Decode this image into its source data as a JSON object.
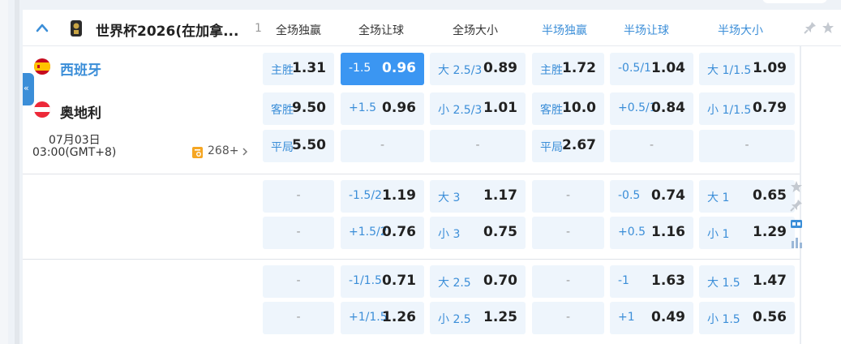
{
  "league": {
    "name": "世界杯2026(在加拿...",
    "count": "1",
    "icon": "trophy-icon"
  },
  "columns": [
    "全场独赢",
    "全场让球",
    "全场大小",
    "半场独赢",
    "半场让球",
    "半场大小"
  ],
  "colors": {
    "accent": "#3b8ed8",
    "active": "#3b96f2",
    "cell": "#eef5fc"
  },
  "match": {
    "home": "西班牙",
    "away": "奥地利",
    "date": "07月03日",
    "time": "03:00(GMT+8)",
    "more": "268+"
  },
  "rows": [
    [
      {
        "lbl": "主胜",
        "val": "1.31"
      },
      {
        "lbl": "-1.5",
        "val": "0.96",
        "active": true
      },
      {
        "lbl": "大 2.5/3",
        "val": "0.89"
      },
      {
        "lbl": "主胜",
        "val": "1.72"
      },
      {
        "lbl": "-0.5/1",
        "val": "1.04"
      },
      {
        "lbl": "大 1/1.5",
        "val": "1.09"
      }
    ],
    [
      {
        "lbl": "客胜",
        "val": "9.50"
      },
      {
        "lbl": "+1.5",
        "val": "0.96"
      },
      {
        "lbl": "小 2.5/3",
        "val": "1.01"
      },
      {
        "lbl": "客胜",
        "val": "10.0"
      },
      {
        "lbl": "+0.5/1",
        "val": "0.84"
      },
      {
        "lbl": "小 1/1.5",
        "val": "0.79"
      }
    ],
    [
      {
        "lbl": "平局",
        "val": "5.50"
      },
      {
        "dash": "-"
      },
      {
        "dash": "-"
      },
      {
        "lbl": "平局",
        "val": "2.67"
      },
      {
        "dash": "-"
      },
      {
        "dash": "-"
      }
    ],
    [
      {
        "dash": "-"
      },
      {
        "lbl": "-1.5/2",
        "val": "1.19"
      },
      {
        "lbl": "大 3",
        "val": "1.17"
      },
      {
        "dash": "-"
      },
      {
        "lbl": "-0.5",
        "val": "0.74"
      },
      {
        "lbl": "大 1",
        "val": "0.65"
      }
    ],
    [
      {
        "dash": "-"
      },
      {
        "lbl": "+1.5/2",
        "val": "0.76"
      },
      {
        "lbl": "小 3",
        "val": "0.75"
      },
      {
        "dash": "-"
      },
      {
        "lbl": "+0.5",
        "val": "1.16"
      },
      {
        "lbl": "小 1",
        "val": "1.29"
      }
    ],
    [
      {
        "dash": "-"
      },
      {
        "lbl": "-1/1.5",
        "val": "0.71"
      },
      {
        "lbl": "大 2.5",
        "val": "0.70"
      },
      {
        "dash": "-"
      },
      {
        "lbl": "-1",
        "val": "1.63"
      },
      {
        "lbl": "大 1.5",
        "val": "1.47"
      }
    ],
    [
      {
        "dash": "-"
      },
      {
        "lbl": "+1/1.5",
        "val": "1.26"
      },
      {
        "lbl": "小 2.5",
        "val": "1.25"
      },
      {
        "dash": "-"
      },
      {
        "lbl": "+1",
        "val": "0.49"
      },
      {
        "lbl": "小 1.5",
        "val": "0.56"
      }
    ]
  ],
  "side_icons": [
    "star-icon",
    "pin-icon",
    "score-icon",
    "stats-icon"
  ],
  "collapse_label": "«"
}
